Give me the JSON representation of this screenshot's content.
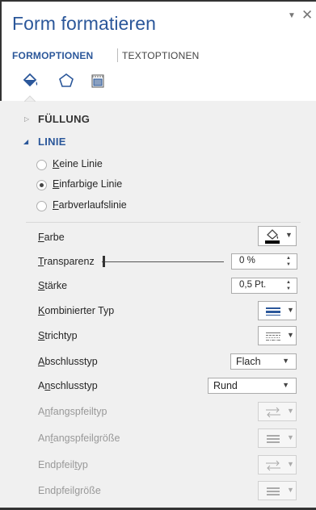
{
  "pane": {
    "title": "Form formatieren",
    "controls": {
      "menu": "▼",
      "close": "✕"
    }
  },
  "tabs": [
    {
      "label": "FORMOPTIONEN",
      "active": true
    },
    {
      "label": "TEXTOPTIONEN",
      "active": false
    }
  ],
  "icon_tabs": [
    "fill-line-icon",
    "effects-icon",
    "size-properties-icon"
  ],
  "sections": {
    "fill": {
      "title": "FÜLLUNG",
      "expanded": false
    },
    "line": {
      "title": "LINIE",
      "expanded": true
    }
  },
  "line_options": [
    {
      "pre": "",
      "u": "K",
      "post": "eine Linie",
      "checked": false
    },
    {
      "pre": "",
      "u": "E",
      "post": "infarbige Linie",
      "checked": true
    },
    {
      "pre": "",
      "u": "F",
      "post": "arbverlaufslinie",
      "checked": false
    }
  ],
  "properties": {
    "farbe": {
      "pre": "",
      "u": "F",
      "post": "arbe"
    },
    "transparenz": {
      "pre": "",
      "u": "T",
      "post": "ransparenz",
      "value": "0 %"
    },
    "staerke": {
      "pre": "",
      "u": "S",
      "post": "tärke",
      "value": "0,5 Pt."
    },
    "kombinierter_typ": {
      "pre": "",
      "u": "K",
      "post": "ombinierter Typ"
    },
    "strichtyp": {
      "pre": "",
      "u": "S",
      "post": "trichtyp"
    },
    "abschlusstyp": {
      "pre": "",
      "u": "A",
      "post": "bschlusstyp",
      "value": "Flach"
    },
    "anschlusstyp": {
      "pre": "A",
      "u": "n",
      "post": "schlusstyp",
      "value": "Rund"
    },
    "anfangspfeiltyp": {
      "pre": "A",
      "u": "n",
      "post": "fangspfeiltyp"
    },
    "anfangspfeilgroesse": {
      "pre": "An",
      "u": "f",
      "post": "angspfeilgröße"
    },
    "endpfeiltyp": {
      "pre": "Endpfeil",
      "u": "t",
      "post": "yp"
    },
    "endpfeilgroesse": {
      "pre": "Endpfeil",
      "u": "g",
      "post": "röße"
    }
  },
  "colors": {
    "accent": "#2b579a",
    "background": "#f0f0f0",
    "disabled_text": "#999999"
  }
}
